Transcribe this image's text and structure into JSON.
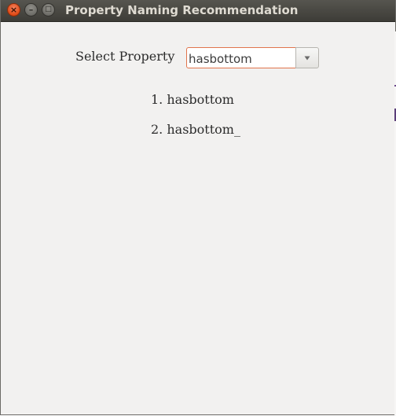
{
  "window": {
    "title": "Property Naming Recommendation",
    "controls": {
      "close_icon": "close-icon",
      "minimize_icon": "minimize-icon",
      "maximize_icon": "maximize-icon"
    }
  },
  "form": {
    "select_label": "Select Property",
    "combo_value": "hasbottom",
    "dropdown_icon": "chevron-down-icon"
  },
  "results": [
    {
      "label": "1. hasbottom"
    },
    {
      "label": "2. hasbottom_"
    }
  ],
  "colors": {
    "titlebar": "#3d3c37",
    "title_text": "#dfdbd2",
    "close_button": "#df4a16",
    "window_background": "#f2f1f0",
    "focus_border": "#e0744c"
  }
}
